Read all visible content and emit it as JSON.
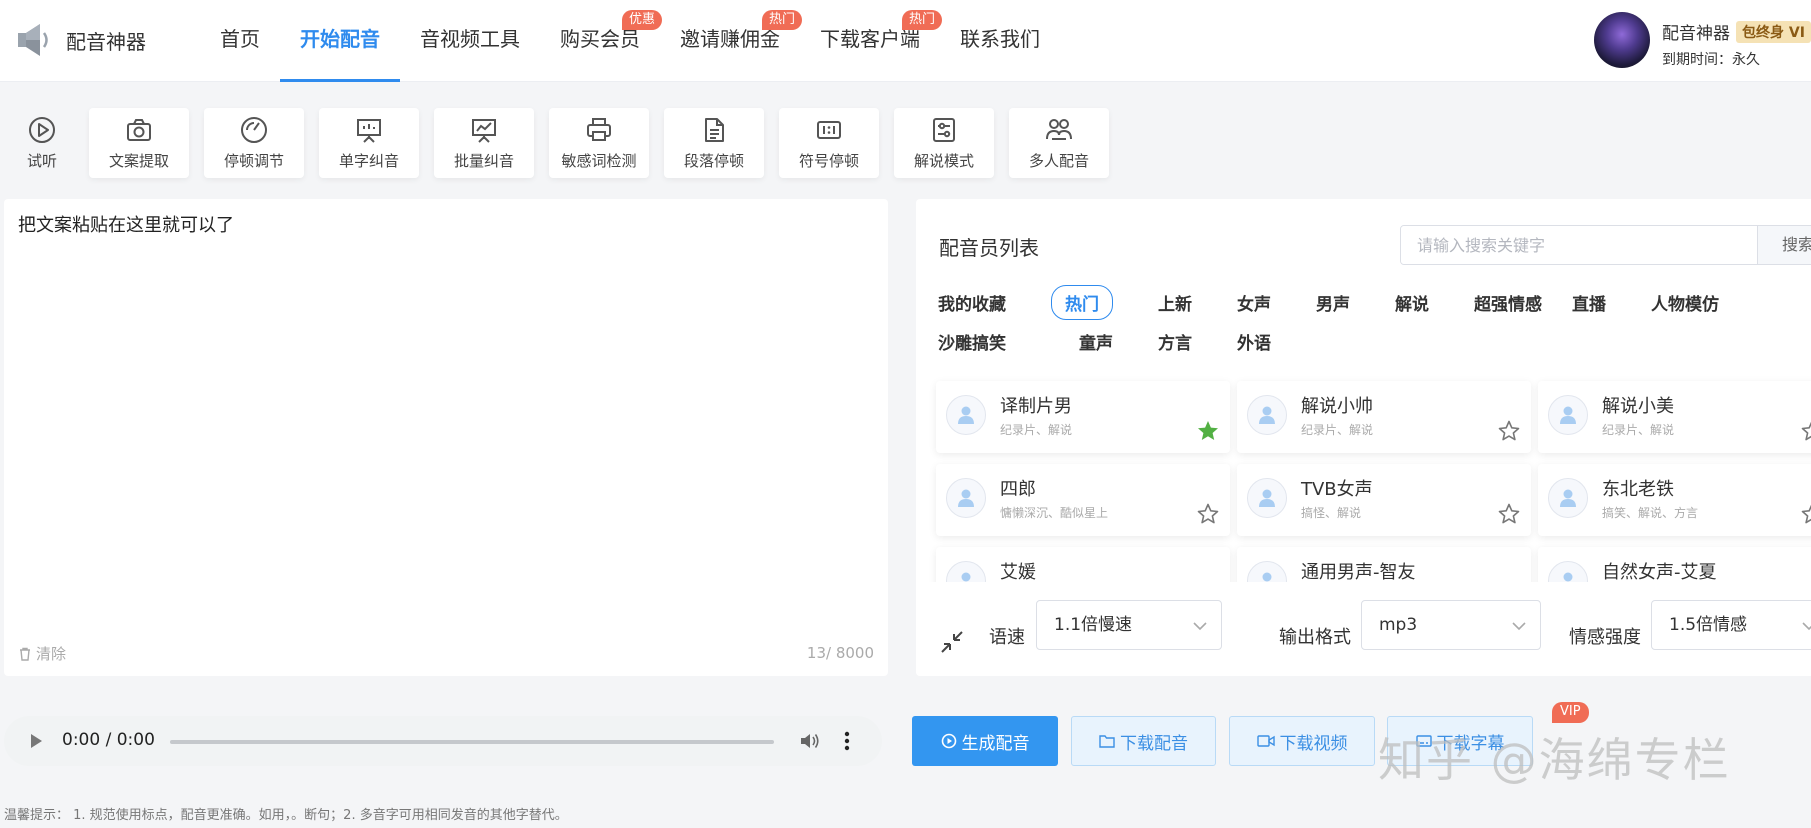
{
  "header": {
    "app_title": "配音神器",
    "nav": [
      {
        "label": "首页",
        "badge": ""
      },
      {
        "label": "开始配音",
        "badge": ""
      },
      {
        "label": "音视频工具",
        "badge": ""
      },
      {
        "label": "购买会员",
        "badge": "优惠"
      },
      {
        "label": "邀请赚佣金",
        "badge": "热门"
      },
      {
        "label": "下载客户端",
        "badge": "热门"
      },
      {
        "label": "联系我们",
        "badge": ""
      }
    ],
    "active_nav": "开始配音",
    "user": {
      "name": "配音神器",
      "vip_tag": "包终身 VI",
      "expire_label": "到期时间：",
      "expire_value": "永久"
    }
  },
  "toolbar": [
    {
      "label": "试听",
      "icon": "play-circle-icon"
    },
    {
      "label": "文案提取",
      "icon": "camera-icon"
    },
    {
      "label": "停顿调节",
      "icon": "gauge-icon"
    },
    {
      "label": "单字纠音",
      "icon": "presentation-board-icon"
    },
    {
      "label": "批量纠音",
      "icon": "chart-board-icon"
    },
    {
      "label": "敏感词检测",
      "icon": "printer-icon"
    },
    {
      "label": "段落停顿",
      "icon": "document-icon"
    },
    {
      "label": "符号停顿",
      "icon": "symbol-box-icon"
    },
    {
      "label": "解说模式",
      "icon": "settings-panel-icon"
    },
    {
      "label": "多人配音",
      "icon": "people-icon"
    }
  ],
  "editor": {
    "text": "把文案粘贴在这里就可以了",
    "clear_label": "清除",
    "char_count": "13/ 8000"
  },
  "voice_panel": {
    "title": "配音员列表",
    "search_placeholder": "请输入搜索关键字",
    "search_button": "搜索",
    "categories": [
      "我的收藏",
      "热门",
      "上新",
      "女声",
      "男声",
      "解说",
      "超强情感",
      "直播",
      "人物模仿",
      "沙雕搞笑",
      "童声",
      "方言",
      "外语"
    ],
    "active_category": "热门",
    "voices": [
      {
        "name": "译制片男",
        "tags": "纪录片、解说",
        "favorite": true
      },
      {
        "name": "解说小帅",
        "tags": "纪录片、解说",
        "favorite": false
      },
      {
        "name": "解说小美",
        "tags": "纪录片、解说",
        "favorite": false
      },
      {
        "name": "四郎",
        "tags": "慵懒深沉、酷似星上",
        "favorite": false
      },
      {
        "name": "TVB女声",
        "tags": "搞怪、解说",
        "favorite": false
      },
      {
        "name": "东北老铁",
        "tags": "搞笑、解说、方言",
        "favorite": false
      },
      {
        "name": "艾媛",
        "tags": "",
        "favorite": false
      },
      {
        "name": "通用男声-智友",
        "tags": "",
        "favorite": false
      },
      {
        "name": "自然女声-艾夏",
        "tags": "",
        "favorite": false
      }
    ],
    "settings": {
      "speed_label": "语速",
      "speed_value": "1.1倍慢速",
      "format_label": "输出格式",
      "format_value": "mp3",
      "emotion_label": "情感强度",
      "emotion_value": "1.5倍情感"
    }
  },
  "player": {
    "time": "0:00 / 0:00"
  },
  "actions": {
    "generate": "生成配音",
    "download_audio": "下载配音",
    "download_video": "下载视频",
    "download_subtitle": "下载字幕",
    "vip_badge": "VIP"
  },
  "tip": "温馨提示： 1. 规范使用标点，配音更准确。如用，。断句；2. 多音字可用相同发音的其他字替代。",
  "watermark": "知乎 @海绵专栏",
  "colors": {
    "accent": "#2f8bee",
    "primary_button": "#3396f0",
    "badge": "#f06c55",
    "favorite_star": "#52b043"
  }
}
